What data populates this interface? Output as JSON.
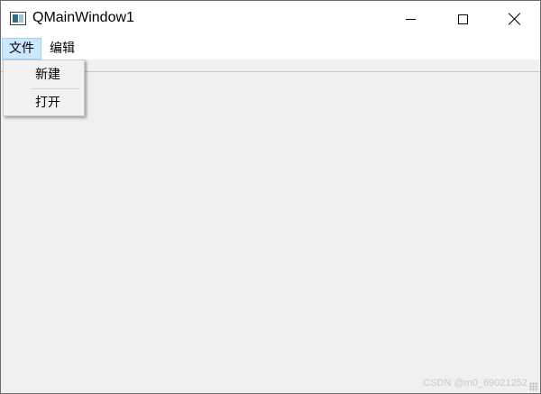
{
  "window": {
    "title": "QMainWindow1"
  },
  "menubar": {
    "items": [
      {
        "label": "文件"
      },
      {
        "label": "编辑"
      }
    ]
  },
  "dropdown": {
    "items": [
      {
        "label": "新建"
      },
      {
        "label": "打开"
      }
    ]
  },
  "watermark": "CSDN @m0_69021252",
  "icons": {
    "app": "app-window-icon",
    "minimize": "minimize-icon",
    "maximize": "maximize-icon",
    "close": "close-icon"
  },
  "colors": {
    "menu_highlight": "#cce8ff",
    "client_bg": "#f0f0f0",
    "titlebar_bg": "#ffffff"
  }
}
